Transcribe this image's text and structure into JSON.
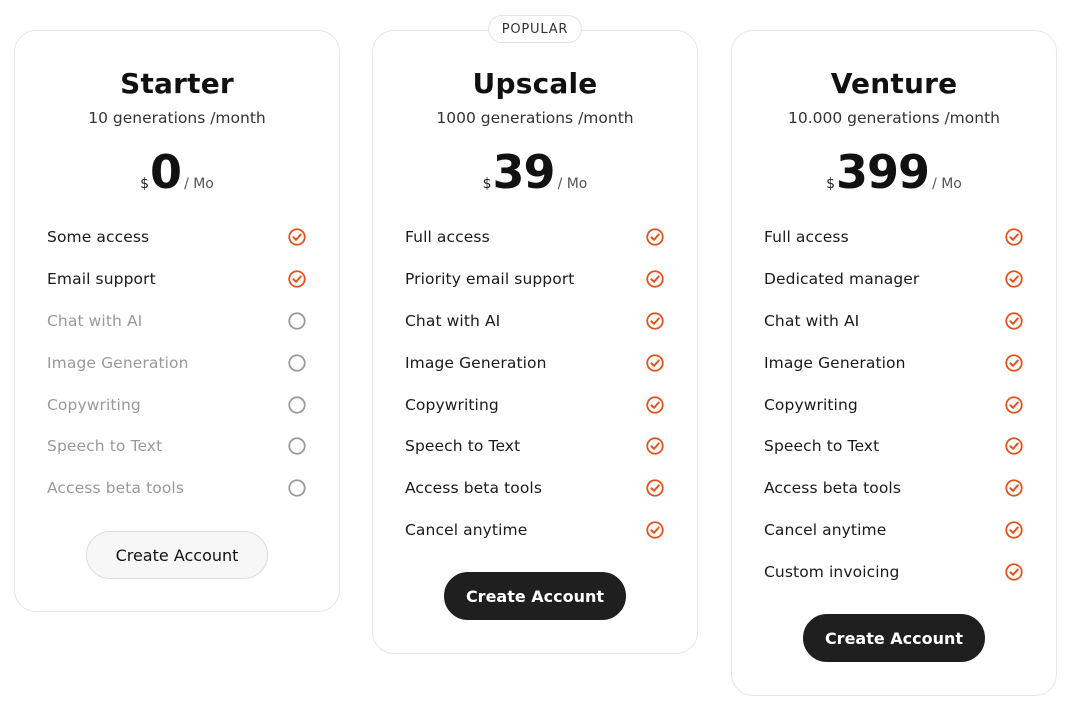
{
  "colors": {
    "accent": "#e0531f",
    "disabled": "#9a9a9a",
    "button_dark": "#1f1f1f"
  },
  "icons": {
    "included": "check-circle-icon",
    "excluded": "empty-circle-icon"
  },
  "popular_badge": "POPULAR",
  "plans": [
    {
      "name": "Starter",
      "quota": "10 generations /month",
      "currency": "$",
      "price": "0",
      "period": "/ Mo",
      "features": [
        {
          "label": "Some access",
          "included": true
        },
        {
          "label": "Email support",
          "included": true
        },
        {
          "label": "Chat with AI",
          "included": false
        },
        {
          "label": "Image Generation",
          "included": false
        },
        {
          "label": "Copywriting",
          "included": false
        },
        {
          "label": "Speech to Text",
          "included": false
        },
        {
          "label": "Access beta tools",
          "included": false
        }
      ],
      "cta": "Create Account"
    },
    {
      "name": "Upscale",
      "quota": "1000 generations /month",
      "currency": "$",
      "price": "39",
      "period": "/ Mo",
      "features": [
        {
          "label": "Full access",
          "included": true
        },
        {
          "label": "Priority email support",
          "included": true
        },
        {
          "label": "Chat with AI",
          "included": true
        },
        {
          "label": "Image Generation",
          "included": true
        },
        {
          "label": "Copywriting",
          "included": true
        },
        {
          "label": "Speech to Text",
          "included": true
        },
        {
          "label": "Access beta tools",
          "included": true
        },
        {
          "label": "Cancel anytime",
          "included": true
        }
      ],
      "cta": "Create Account"
    },
    {
      "name": "Venture",
      "quota": "10.000 generations /month",
      "currency": "$",
      "price": "399",
      "period": "/ Mo",
      "features": [
        {
          "label": "Full access",
          "included": true
        },
        {
          "label": "Dedicated manager",
          "included": true
        },
        {
          "label": "Chat with AI",
          "included": true
        },
        {
          "label": "Image Generation",
          "included": true
        },
        {
          "label": "Copywriting",
          "included": true
        },
        {
          "label": "Speech to Text",
          "included": true
        },
        {
          "label": "Access beta tools",
          "included": true
        },
        {
          "label": "Cancel anytime",
          "included": true
        },
        {
          "label": "Custom invoicing",
          "included": true
        }
      ],
      "cta": "Create Account"
    }
  ]
}
